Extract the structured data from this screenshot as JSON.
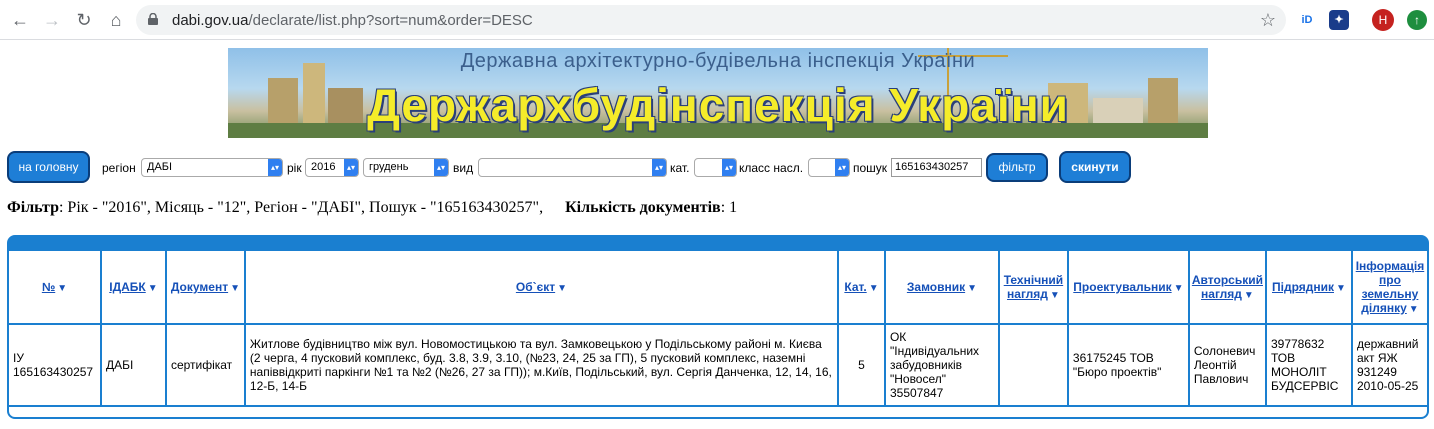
{
  "browser": {
    "url_host": "dabi.gov.ua",
    "url_path": "/declarate/list.php?sort=num&order=DESC",
    "avatar_letter": "H"
  },
  "banner": {
    "subtitle": "Державна архітектурно-будівельна інспекція України",
    "title": "Держархбудінспекція України"
  },
  "filters": {
    "home_button": "на головну",
    "region_label": "регіон",
    "region_value": "ДАБІ",
    "year_label": "рік",
    "year_value": "2016",
    "month_value": "грудень",
    "type_label": "вид",
    "type_value": "",
    "category_label": "кат.",
    "category_value": "",
    "class_label": "класс насл.",
    "class_value": "",
    "search_label": "пошук",
    "search_value": "165163430257",
    "filter_button": "фільтр",
    "reset_button": "скинути"
  },
  "summary": {
    "filter_label": "Фільтр",
    "filter_text": ": Рік - \"2016\", Місяць - \"12\", Регіон - \"ДАБІ\", Пошук - \"165163430257\",",
    "count_label": "Кількість документів",
    "count_value": ": 1"
  },
  "table": {
    "columns": [
      "№",
      "ІДАБК",
      "Документ",
      "Об`єкт",
      "Кат.",
      "Замовник",
      "Технічний нагляд",
      "Проектувальник",
      "Авторський нагляд",
      "Підрядник",
      "Інформація про земельну ділянку"
    ],
    "rows": [
      {
        "num": "ІУ 165163430257",
        "idabk": "ДАБІ",
        "document": "сертифікат",
        "object": "Житлове будівництво між вул. Новомостицькою та вул. Замковецькою у Подільському районі м. Києва (2 черга, 4 пусковий комплекс, буд. 3.8, 3.9, 3.10, (№23, 24, 25 за ГП), 5 пусковий комплекс, наземні напіввідкриті паркінги №1 та №2 (№26, 27 за ГП)); м.Київ, Подільський, вул. Сергія Данченка, 12, 14, 16, 12-Б, 14-Б",
        "category": "5",
        "customer": "ОК \"Індивідуальних забудовників \"Новосел\" 35507847",
        "tech_supervision": "",
        "designer": "36175245 ТОВ \"Бюро проектів\"",
        "author_supervision": "Солоневич Леонтій Павлович",
        "contractor": "39778632 ТОВ МОНОЛІТ БУДСЕРВІС",
        "land_info": "державний акт ЯЖ 931249 2010-05-25"
      }
    ]
  }
}
